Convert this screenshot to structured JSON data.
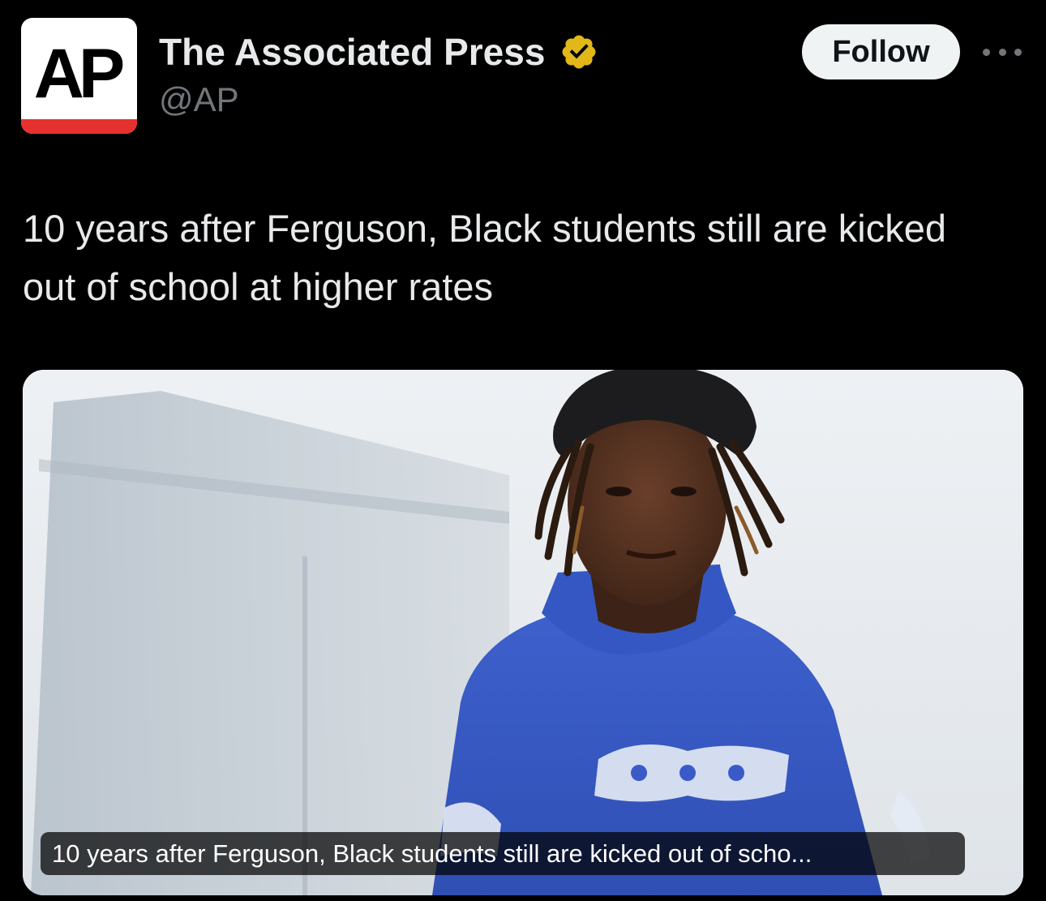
{
  "author": {
    "display_name": "The Associated Press",
    "handle": "@AP",
    "avatar_text": "AP",
    "verified": true,
    "verified_badge_color": "#e2b719"
  },
  "actions": {
    "follow_label": "Follow",
    "more_icon": "more-horizontal-icon"
  },
  "tweet": {
    "text": "10 years after Ferguson, Black students still are kicked out of school at higher rates"
  },
  "media": {
    "caption": "10 years after Ferguson, Black students still are kicked out of scho..."
  },
  "colors": {
    "background": "#000000",
    "primary_text": "#e7e9ea",
    "secondary_text": "#71767b",
    "ap_red": "#e5322f",
    "hoodie_blue": "#3a5bc7"
  }
}
